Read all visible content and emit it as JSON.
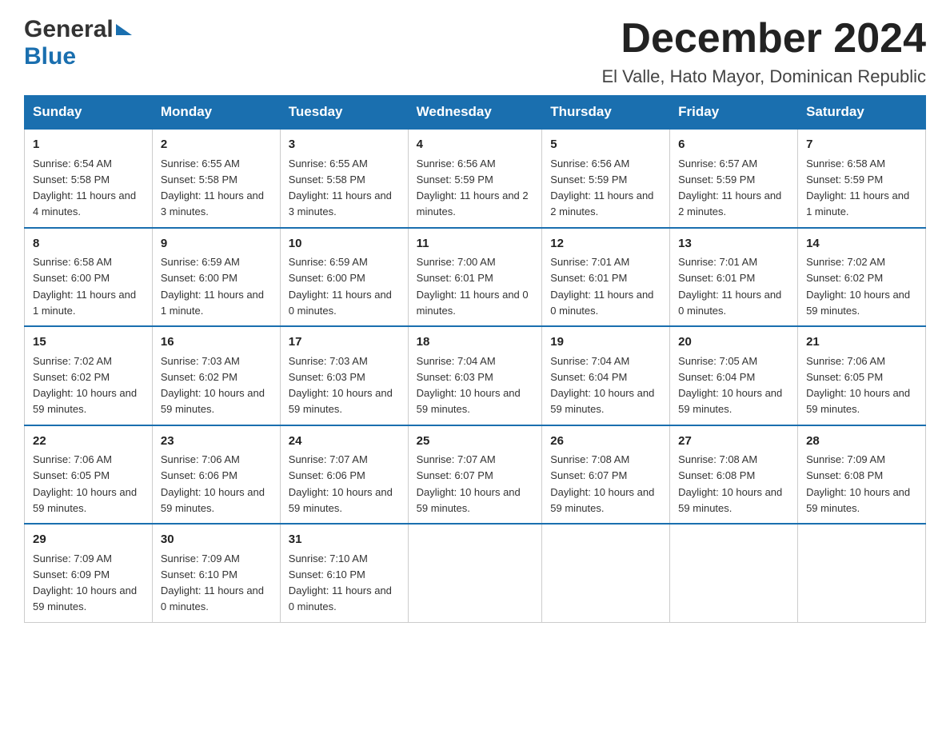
{
  "logo": {
    "general": "General",
    "blue": "Blue"
  },
  "header": {
    "title": "December 2024",
    "subtitle": "El Valle, Hato Mayor, Dominican Republic"
  },
  "columns": [
    "Sunday",
    "Monday",
    "Tuesday",
    "Wednesday",
    "Thursday",
    "Friday",
    "Saturday"
  ],
  "weeks": [
    [
      {
        "day": "1",
        "sunrise": "6:54 AM",
        "sunset": "5:58 PM",
        "daylight": "11 hours and 4 minutes."
      },
      {
        "day": "2",
        "sunrise": "6:55 AM",
        "sunset": "5:58 PM",
        "daylight": "11 hours and 3 minutes."
      },
      {
        "day": "3",
        "sunrise": "6:55 AM",
        "sunset": "5:58 PM",
        "daylight": "11 hours and 3 minutes."
      },
      {
        "day": "4",
        "sunrise": "6:56 AM",
        "sunset": "5:59 PM",
        "daylight": "11 hours and 2 minutes."
      },
      {
        "day": "5",
        "sunrise": "6:56 AM",
        "sunset": "5:59 PM",
        "daylight": "11 hours and 2 minutes."
      },
      {
        "day": "6",
        "sunrise": "6:57 AM",
        "sunset": "5:59 PM",
        "daylight": "11 hours and 2 minutes."
      },
      {
        "day": "7",
        "sunrise": "6:58 AM",
        "sunset": "5:59 PM",
        "daylight": "11 hours and 1 minute."
      }
    ],
    [
      {
        "day": "8",
        "sunrise": "6:58 AM",
        "sunset": "6:00 PM",
        "daylight": "11 hours and 1 minute."
      },
      {
        "day": "9",
        "sunrise": "6:59 AM",
        "sunset": "6:00 PM",
        "daylight": "11 hours and 1 minute."
      },
      {
        "day": "10",
        "sunrise": "6:59 AM",
        "sunset": "6:00 PM",
        "daylight": "11 hours and 0 minutes."
      },
      {
        "day": "11",
        "sunrise": "7:00 AM",
        "sunset": "6:01 PM",
        "daylight": "11 hours and 0 minutes."
      },
      {
        "day": "12",
        "sunrise": "7:01 AM",
        "sunset": "6:01 PM",
        "daylight": "11 hours and 0 minutes."
      },
      {
        "day": "13",
        "sunrise": "7:01 AM",
        "sunset": "6:01 PM",
        "daylight": "11 hours and 0 minutes."
      },
      {
        "day": "14",
        "sunrise": "7:02 AM",
        "sunset": "6:02 PM",
        "daylight": "10 hours and 59 minutes."
      }
    ],
    [
      {
        "day": "15",
        "sunrise": "7:02 AM",
        "sunset": "6:02 PM",
        "daylight": "10 hours and 59 minutes."
      },
      {
        "day": "16",
        "sunrise": "7:03 AM",
        "sunset": "6:02 PM",
        "daylight": "10 hours and 59 minutes."
      },
      {
        "day": "17",
        "sunrise": "7:03 AM",
        "sunset": "6:03 PM",
        "daylight": "10 hours and 59 minutes."
      },
      {
        "day": "18",
        "sunrise": "7:04 AM",
        "sunset": "6:03 PM",
        "daylight": "10 hours and 59 minutes."
      },
      {
        "day": "19",
        "sunrise": "7:04 AM",
        "sunset": "6:04 PM",
        "daylight": "10 hours and 59 minutes."
      },
      {
        "day": "20",
        "sunrise": "7:05 AM",
        "sunset": "6:04 PM",
        "daylight": "10 hours and 59 minutes."
      },
      {
        "day": "21",
        "sunrise": "7:06 AM",
        "sunset": "6:05 PM",
        "daylight": "10 hours and 59 minutes."
      }
    ],
    [
      {
        "day": "22",
        "sunrise": "7:06 AM",
        "sunset": "6:05 PM",
        "daylight": "10 hours and 59 minutes."
      },
      {
        "day": "23",
        "sunrise": "7:06 AM",
        "sunset": "6:06 PM",
        "daylight": "10 hours and 59 minutes."
      },
      {
        "day": "24",
        "sunrise": "7:07 AM",
        "sunset": "6:06 PM",
        "daylight": "10 hours and 59 minutes."
      },
      {
        "day": "25",
        "sunrise": "7:07 AM",
        "sunset": "6:07 PM",
        "daylight": "10 hours and 59 minutes."
      },
      {
        "day": "26",
        "sunrise": "7:08 AM",
        "sunset": "6:07 PM",
        "daylight": "10 hours and 59 minutes."
      },
      {
        "day": "27",
        "sunrise": "7:08 AM",
        "sunset": "6:08 PM",
        "daylight": "10 hours and 59 minutes."
      },
      {
        "day": "28",
        "sunrise": "7:09 AM",
        "sunset": "6:08 PM",
        "daylight": "10 hours and 59 minutes."
      }
    ],
    [
      {
        "day": "29",
        "sunrise": "7:09 AM",
        "sunset": "6:09 PM",
        "daylight": "10 hours and 59 minutes."
      },
      {
        "day": "30",
        "sunrise": "7:09 AM",
        "sunset": "6:10 PM",
        "daylight": "11 hours and 0 minutes."
      },
      {
        "day": "31",
        "sunrise": "7:10 AM",
        "sunset": "6:10 PM",
        "daylight": "11 hours and 0 minutes."
      },
      null,
      null,
      null,
      null
    ]
  ]
}
